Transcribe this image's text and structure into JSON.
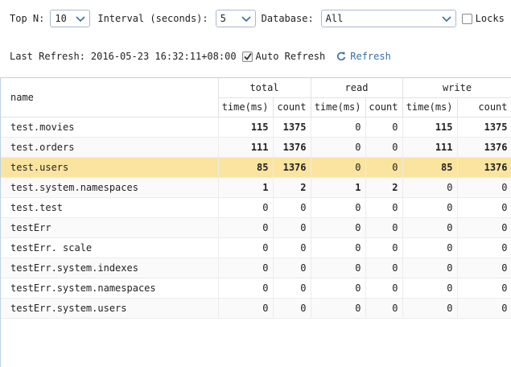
{
  "toolbar": {
    "top_n_label": "Top N:",
    "top_n_value": "10",
    "interval_label": "Interval (seconds):",
    "interval_value": "5",
    "database_label": "Database:",
    "database_value": "All",
    "locks_label": "Locks",
    "locks_checked": false
  },
  "refresh": {
    "last_refresh_label": "Last Refresh:",
    "last_refresh_value": "2016-05-23 16:32:11+08:00",
    "auto_refresh_label": "Auto Refresh",
    "auto_refresh_checked": true,
    "refresh_label": "Refresh"
  },
  "table": {
    "name_header": "name",
    "groups": [
      "total",
      "read",
      "write"
    ],
    "sub_headers": [
      "time(ms)",
      "count",
      "time(ms)",
      "count",
      "time(ms)",
      "count"
    ],
    "rows": [
      {
        "name": "test.movies",
        "values": [
          "115",
          "1375",
          "0",
          "0",
          "115",
          "1375"
        ]
      },
      {
        "name": "test.orders",
        "values": [
          "111",
          "1376",
          "0",
          "0",
          "111",
          "1376"
        ]
      },
      {
        "name": "test.users",
        "values": [
          "85",
          "1376",
          "0",
          "0",
          "85",
          "1376"
        ],
        "selected": true
      },
      {
        "name": "test.system.namespaces",
        "values": [
          "1",
          "2",
          "1",
          "2",
          "0",
          "0"
        ]
      },
      {
        "name": "test.test",
        "values": [
          "0",
          "0",
          "0",
          "0",
          "0",
          "0"
        ]
      },
      {
        "name": "testErr",
        "values": [
          "0",
          "0",
          "0",
          "0",
          "0",
          "0"
        ]
      },
      {
        "name": "testErr. scale",
        "values": [
          "0",
          "0",
          "0",
          "0",
          "0",
          "0"
        ]
      },
      {
        "name": "testErr.system.indexes",
        "values": [
          "0",
          "0",
          "0",
          "0",
          "0",
          "0"
        ]
      },
      {
        "name": "testErr.system.namespaces",
        "values": [
          "0",
          "0",
          "0",
          "0",
          "0",
          "0"
        ]
      },
      {
        "name": "testErr.system.users",
        "values": [
          "0",
          "0",
          "0",
          "0",
          "0",
          "0"
        ]
      }
    ]
  },
  "colors": {
    "selected_row": "#fbe4a0",
    "accent": "#3a6ea5",
    "select_border": "#a9b8cf"
  }
}
